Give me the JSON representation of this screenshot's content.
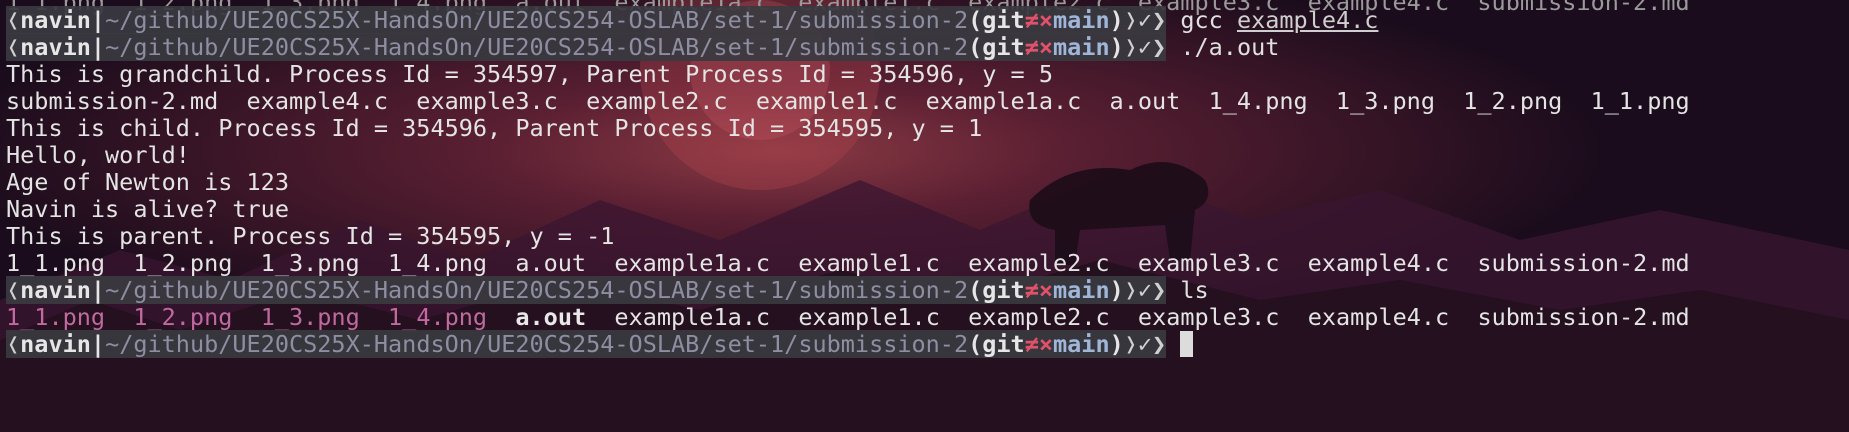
{
  "terminal": {
    "prompt": {
      "left_glyph": "❬",
      "user": "navin",
      "separator": "|",
      "path": "~/github/UE20CS25X-HandsOn/UE20CS254-OSLAB/set-1/submission-2",
      "git_open": "(git",
      "dirty_glyph": "≠×",
      "branch": "main",
      "git_close": ")",
      "end_glyph": "❭✓❯"
    },
    "commands": {
      "cmd1_program": "gcc",
      "cmd1_arg": "example4.c",
      "cmd2": "./a.out",
      "cmd3": "ls"
    },
    "output": {
      "line1": "This is grandchild. Process Id = 354597, Parent Process Id = 354596, y = 5",
      "line2": "submission-2.md  example4.c  example3.c  example2.c  example1.c  example1a.c  a.out  1_4.png  1_3.png  1_2.png  1_1.png",
      "line3": "This is child. Process Id = 354596, Parent Process Id = 354595, y = 1",
      "line4": "Hello, world!",
      "line5": "Age of Newton is 123",
      "line6": "Navin is alive? true",
      "line7": "This is parent. Process Id = 354595, y = -1",
      "line8": "1_1.png  1_2.png  1_3.png  1_4.png  a.out  example1a.c  example1.c  example2.c  example3.c  example4.c  submission-2.md"
    },
    "ls_listing": {
      "images": [
        "1_1.png",
        "1_2.png",
        "1_3.png",
        "1_4.png"
      ],
      "exe": "a.out",
      "files": [
        "example1a.c",
        "example1.c",
        "example2.c",
        "example3.c",
        "example4.c",
        "submission-2.md"
      ]
    },
    "colors": {
      "prompt_bg": "#3a3a40",
      "dirty": "#e2516a",
      "branch": "#9fb6d9",
      "path": "#8e8ea2",
      "image_files": "#c06aa0"
    }
  }
}
